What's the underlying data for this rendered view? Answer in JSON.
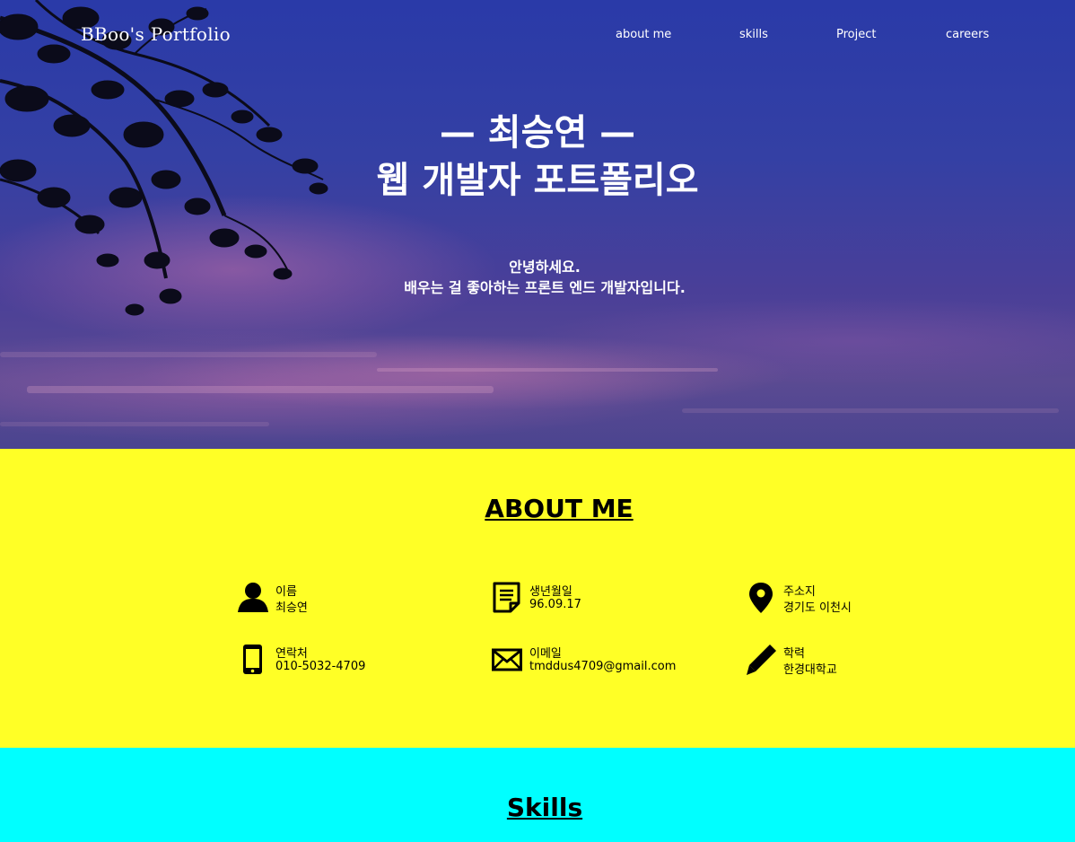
{
  "header": {
    "brand": "BBoo's Portfolio",
    "nav": [
      {
        "label": "about me"
      },
      {
        "label": "skills"
      },
      {
        "label": "Project"
      },
      {
        "label": "careers"
      }
    ]
  },
  "hero": {
    "name_line": "— 최승연 —",
    "title_line": "웹 개발자 포트폴리오",
    "greeting": "안녕하세요.",
    "intro": "배우는 걸 좋아하는 프론트 엔드 개발자입니다."
  },
  "about": {
    "heading": "ABOUT ME",
    "items": [
      {
        "icon": "person-icon",
        "label": "이름",
        "value": "최승연"
      },
      {
        "icon": "document-icon",
        "label": "생년월일",
        "value": "96.09.17"
      },
      {
        "icon": "map-pin-icon",
        "label": "주소지",
        "value": "경기도 이천시"
      },
      {
        "icon": "mobile-phone-icon",
        "label": "연락처",
        "value": "010-5032-4709"
      },
      {
        "icon": "envelope-icon",
        "label": "이메일",
        "value": "tmddus4709@gmail.com"
      },
      {
        "icon": "pencil-icon",
        "label": "학력",
        "value": "한경대학교"
      }
    ]
  },
  "skills": {
    "heading": "Skills"
  },
  "colors": {
    "about_bg": "#ffff26",
    "skills_bg": "#00ffff",
    "hero_sky": "#2a3aa8"
  }
}
